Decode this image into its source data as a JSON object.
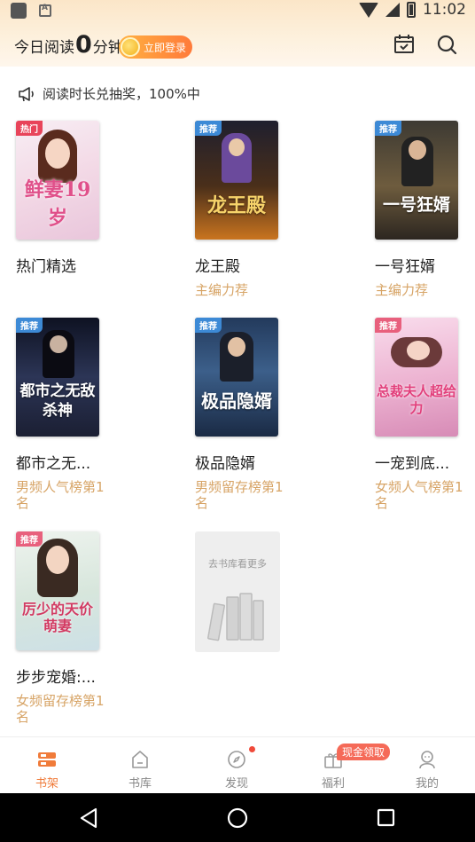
{
  "status_bar": {
    "time": "11:02"
  },
  "header": {
    "reading_prefix": "今日阅读",
    "reading_minutes": "0",
    "reading_suffix": "分钟",
    "login_label": "立即登录",
    "icons": [
      "calendar-icon",
      "search-icon"
    ]
  },
  "notice": {
    "text": "阅读时长兑抽奖，100%中"
  },
  "books": [
    {
      "name": "热门精选",
      "tag": "热门",
      "sub": "",
      "cover_title": "鲜妻19岁"
    },
    {
      "name": "龙王殿",
      "tag": "推荐",
      "sub": "主编力荐",
      "cover_title": "龙王殿"
    },
    {
      "name": "一号狂婿",
      "tag": "推荐",
      "sub": "主编力荐",
      "cover_title": "一号狂婿"
    },
    {
      "name": "都市之无...",
      "tag": "推荐",
      "sub": "男频人气榜第1名",
      "cover_title": "都市之无敌杀神"
    },
    {
      "name": "极品隐婿",
      "tag": "推荐",
      "sub": "男频留存榜第1名",
      "cover_title": "极品隐婿"
    },
    {
      "name": "一宠到底...",
      "tag": "推荐",
      "sub": "女频人气榜第1名",
      "cover_title": "总裁夫人超给力"
    },
    {
      "name": "步步宠婚:...",
      "tag": "推荐",
      "sub": "女频留存榜第1名",
      "cover_title": "厉少的天价萌妻"
    }
  ],
  "more_card": {
    "text": "去书库看更多"
  },
  "nav": {
    "items": [
      "书架",
      "书库",
      "发现",
      "福利",
      "我的"
    ],
    "cash_badge": "现金领取"
  },
  "colors": {
    "accent": "#f07b3a",
    "sub_text": "#d7a466"
  }
}
